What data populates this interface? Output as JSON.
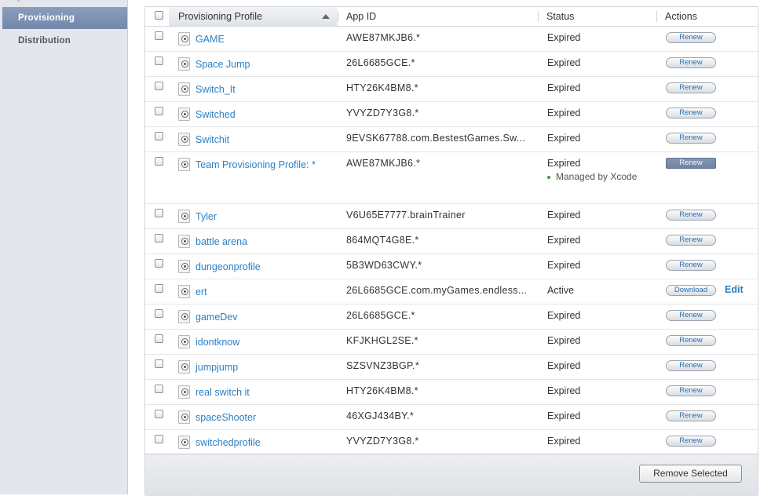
{
  "sidebar": {
    "items": [
      {
        "label": "Provisioning",
        "active": true
      },
      {
        "label": "Distribution",
        "active": false
      }
    ]
  },
  "table": {
    "headers": {
      "profile": "Provisioning Profile",
      "app_id": "App ID",
      "status": "Status",
      "actions": "Actions"
    },
    "rows": [
      {
        "name": "GAME",
        "app_id": "AWE87MKJB6.*",
        "status": "Expired",
        "action": "Renew"
      },
      {
        "name": "Space Jump",
        "app_id": "26L6685GCE.*",
        "status": "Expired",
        "action": "Renew"
      },
      {
        "name": "Switch_It",
        "app_id": "HTY26K4BM8.*",
        "status": "Expired",
        "action": "Renew"
      },
      {
        "name": "Switched",
        "app_id": "YVYZD7Y3G8.*",
        "status": "Expired",
        "action": "Renew"
      },
      {
        "name": "Switchit",
        "app_id": "9EVSK67788.com.BestestGames.Sw...",
        "status": "Expired",
        "action": "Renew"
      },
      {
        "name": "Team Provisioning Profile: *",
        "app_id": "AWE87MKJB6.*",
        "status": "Expired",
        "note": "Managed by Xcode",
        "action": "Renew"
      },
      {
        "name": "Tyler",
        "app_id": "V6U65E7777.brainTrainer",
        "status": "Expired",
        "action": "Renew"
      },
      {
        "name": "battle arena",
        "app_id": "864MQT4G8E.*",
        "status": "Expired",
        "action": "Renew"
      },
      {
        "name": "dungeonprofile",
        "app_id": "5B3WD63CWY.*",
        "status": "Expired",
        "action": "Renew"
      },
      {
        "name": "ert",
        "app_id": "26L6685GCE.com.myGames.endless...",
        "status": "Active",
        "action": "Download",
        "edit": "Edit"
      },
      {
        "name": "gameDev",
        "app_id": "26L6685GCE.*",
        "status": "Expired",
        "action": "Renew"
      },
      {
        "name": "idontknow",
        "app_id": "KFJKHGL2SE.*",
        "status": "Expired",
        "action": "Renew"
      },
      {
        "name": "jumpjump",
        "app_id": "SZSVNZ3BGP.*",
        "status": "Expired",
        "action": "Renew"
      },
      {
        "name": "real switch it",
        "app_id": "HTY26K4BM8.*",
        "status": "Expired",
        "action": "Renew"
      },
      {
        "name": "spaceShooter",
        "app_id": "46XGJ434BY.*",
        "status": "Expired",
        "action": "Renew"
      },
      {
        "name": "switchedprofile",
        "app_id": "YVYZD7Y3G8.*",
        "status": "Expired",
        "action": "Renew"
      }
    ]
  },
  "footer": {
    "remove_label": "Remove Selected"
  },
  "colors": {
    "link": "#2a7fc4",
    "sidebar_active": "#7f93b3",
    "managed_dot": "#3a9a3a"
  },
  "icons": {
    "row_icon": "provisioning-profile-icon"
  }
}
